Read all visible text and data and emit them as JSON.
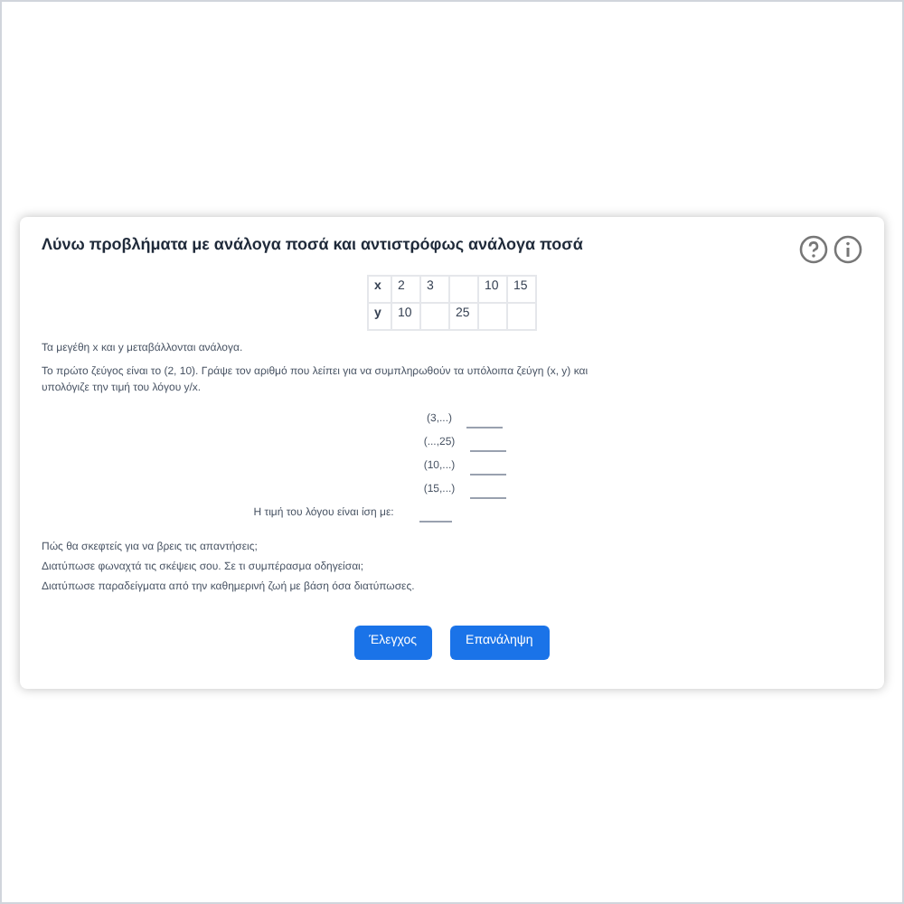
{
  "title": "Λύνω προβλήματα με ανάλογα ποσά και αντιστρόφως ανάλογα ποσά",
  "table": {
    "rows": [
      {
        "header": "x",
        "cells": [
          "2",
          "3",
          "",
          "10",
          "15"
        ]
      },
      {
        "header": "y",
        "cells": [
          "10",
          "",
          "25",
          "",
          ""
        ]
      }
    ]
  },
  "instructions": [
    "Τα μεγέθη x και y μεταβάλλονται ανάλογα.",
    "Το πρώτο ζεύγος είναι το (2, 10). Γράψε τον αριθμό που λείπει για να συμπληρωθούν τα υπόλοιπα ζεύγη (x, y) και υπολόγιζε την τιμή του λόγου y/x."
  ],
  "pairs": [
    "(3,...)",
    "(...,25)",
    "(10,...)",
    "(15,...)"
  ],
  "ratio_label": "Η τιμή του λόγου είναι ίση με:",
  "questions": [
    "Πώς θα σκεφτείς για να βρεις τις απαντήσεις;",
    "Διατύπωσε φωναχτά τις σκέψεις σου. Σε τι συμπέρασμα οδηγείσαι;",
    "Διατύπωσε παραδείγματα από την καθημερινή ζωή με βάση όσα διατύπωσες."
  ],
  "buttons": [
    "Έλεγχος",
    "Επανάληψη"
  ]
}
